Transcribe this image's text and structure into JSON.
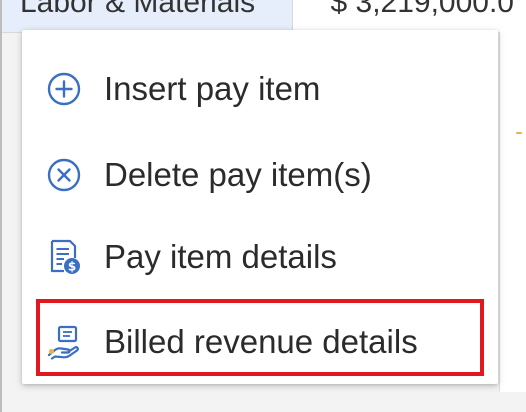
{
  "background": {
    "row_left_text": "Labor & Materials",
    "row_right_text": "$ 3,219,000.0"
  },
  "context_menu": {
    "items": [
      {
        "label": "Insert pay item",
        "icon": "plus-circle-icon"
      },
      {
        "label": "Delete pay item(s)",
        "icon": "x-circle-icon"
      },
      {
        "label": "Pay item details",
        "icon": "document-dollar-icon"
      },
      {
        "label": "Billed revenue details",
        "icon": "hand-bill-icon",
        "highlighted": true
      }
    ]
  },
  "colors": {
    "icon_blue": "#3a6fc4",
    "highlight_red": "#e0191f",
    "text": "#2b2b2b",
    "row_selected": "#e6eefb",
    "accent_yellow": "#e7b44b"
  }
}
